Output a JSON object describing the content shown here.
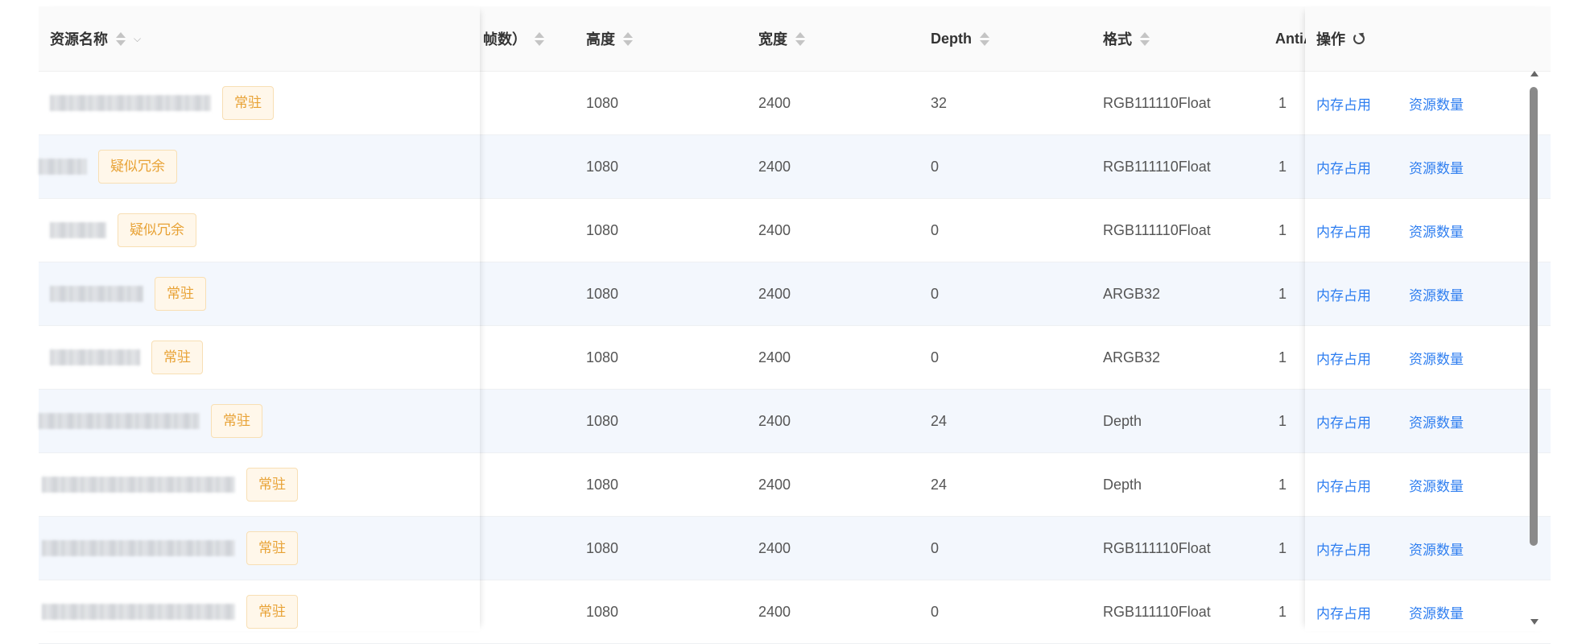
{
  "columns": {
    "name": "资源名称",
    "frames": "帧数）",
    "height": "高度",
    "width": "宽度",
    "depth": "Depth",
    "format": "格式",
    "antialias": "AntiAl",
    "actions": "操作"
  },
  "rows": [
    {
      "tag": "常驻",
      "height": "1080",
      "width": "2400",
      "depth": "32",
      "format": "RGB111110Float",
      "antialias": "1",
      "action1": "内存占用",
      "action2": "资源数量"
    },
    {
      "tag": "疑似冗余",
      "height": "1080",
      "width": "2400",
      "depth": "0",
      "format": "RGB111110Float",
      "antialias": "1",
      "action1": "内存占用",
      "action2": "资源数量"
    },
    {
      "tag": "疑似冗余",
      "height": "1080",
      "width": "2400",
      "depth": "0",
      "format": "RGB111110Float",
      "antialias": "1",
      "action1": "内存占用",
      "action2": "资源数量"
    },
    {
      "tag": "常驻",
      "height": "1080",
      "width": "2400",
      "depth": "0",
      "format": "ARGB32",
      "antialias": "1",
      "action1": "内存占用",
      "action2": "资源数量"
    },
    {
      "tag": "常驻",
      "height": "1080",
      "width": "2400",
      "depth": "0",
      "format": "ARGB32",
      "antialias": "1",
      "action1": "内存占用",
      "action2": "资源数量"
    },
    {
      "tag": "常驻",
      "height": "1080",
      "width": "2400",
      "depth": "24",
      "format": "Depth",
      "antialias": "1",
      "action1": "内存占用",
      "action2": "资源数量"
    },
    {
      "tag": "常驻",
      "height": "1080",
      "width": "2400",
      "depth": "24",
      "format": "Depth",
      "antialias": "1",
      "action1": "内存占用",
      "action2": "资源数量"
    },
    {
      "tag": "常驻",
      "height": "1080",
      "width": "2400",
      "depth": "0",
      "format": "RGB111110Float",
      "antialias": "1",
      "action1": "内存占用",
      "action2": "资源数量"
    },
    {
      "tag": "常驻",
      "height": "1080",
      "width": "2400",
      "depth": "0",
      "format": "RGB111110Float",
      "antialias": "1",
      "action1": "内存占用",
      "action2": "资源数量"
    }
  ],
  "icons": {
    "sort": "sort-icon",
    "filter": "chevron-down-icon",
    "refresh": "refresh-icon"
  },
  "colors": {
    "link": "#2e7ef0",
    "tag_text": "#e8a235",
    "tag_bg": "#fff7ea",
    "row_alt_bg": "#f3f7fd"
  }
}
